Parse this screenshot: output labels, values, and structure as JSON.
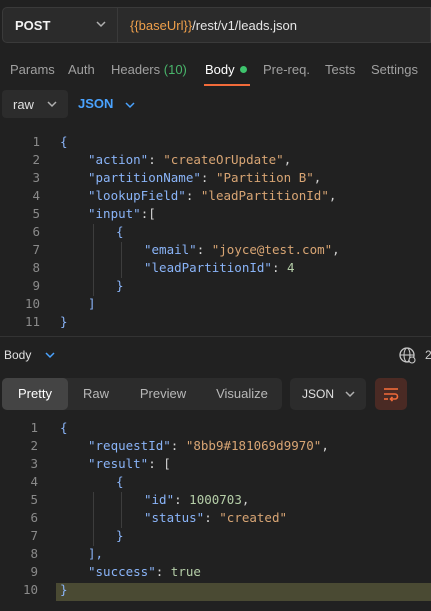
{
  "request": {
    "method": "POST",
    "url_variable": "{{baseUrl}}",
    "url_path": "/rest/v1/leads.json",
    "tabs": [
      {
        "label": "Params"
      },
      {
        "label": "Auth"
      },
      {
        "label": "Headers",
        "count": "(10)"
      },
      {
        "label": "Body"
      },
      {
        "label": "Pre-req."
      },
      {
        "label": "Tests"
      },
      {
        "label": "Settings"
      }
    ],
    "active_tab": "Body",
    "body_mode": "raw",
    "body_language": "JSON",
    "code_lines": [
      {
        "n": "1",
        "text": "{"
      },
      {
        "n": "2",
        "key": "\"action\"",
        "value": "\"createOrUpdate\"",
        "trail": ","
      },
      {
        "n": "3",
        "key": "\"partitionName\"",
        "value": "\"Partition B\"",
        "trail": ","
      },
      {
        "n": "4",
        "key": "\"lookupField\"",
        "value": "\"leadPartitionId\"",
        "trail": ","
      },
      {
        "n": "5",
        "key": "\"input\"",
        "text": ":["
      },
      {
        "n": "6",
        "text": "{"
      },
      {
        "n": "7",
        "key": "\"email\"",
        "value": "\"joyce@test.com\"",
        "trail": ","
      },
      {
        "n": "8",
        "key": "\"leadPartitionId\"",
        "value": "4"
      },
      {
        "n": "9",
        "text": "}"
      },
      {
        "n": "10",
        "text": "]"
      },
      {
        "n": "11",
        "text": "}"
      }
    ]
  },
  "response": {
    "section_label": "Body",
    "truncated_text": "2",
    "view_tabs": [
      "Pretty",
      "Raw",
      "Preview",
      "Visualize"
    ],
    "active_view": "Pretty",
    "format": "JSON",
    "code_lines": [
      {
        "n": "1",
        "text": "{"
      },
      {
        "n": "2",
        "key": "\"requestId\"",
        "value": "\"8bb9#181069d9970\"",
        "trail": ","
      },
      {
        "n": "3",
        "key": "\"result\"",
        "text": ": ["
      },
      {
        "n": "4",
        "text": "{"
      },
      {
        "n": "5",
        "key": "\"id\"",
        "value": "1000703",
        "trail": ","
      },
      {
        "n": "6",
        "key": "\"status\"",
        "value": "\"created\""
      },
      {
        "n": "7",
        "text": "}"
      },
      {
        "n": "8",
        "text": "],"
      },
      {
        "n": "9",
        "key": "\"success\"",
        "value": "true"
      },
      {
        "n": "10",
        "text": "}"
      }
    ]
  },
  "colors": {
    "accent_tab": "#f26b3a",
    "body_dot": "#3ec46d",
    "json_link": "#4aa3ff",
    "url_variable": "#f0a04b",
    "key": "#8ab4f8",
    "string": "#d8a574"
  },
  "icons": [
    "chevron-down-icon",
    "globe-icon",
    "wrap-lines-icon"
  ]
}
